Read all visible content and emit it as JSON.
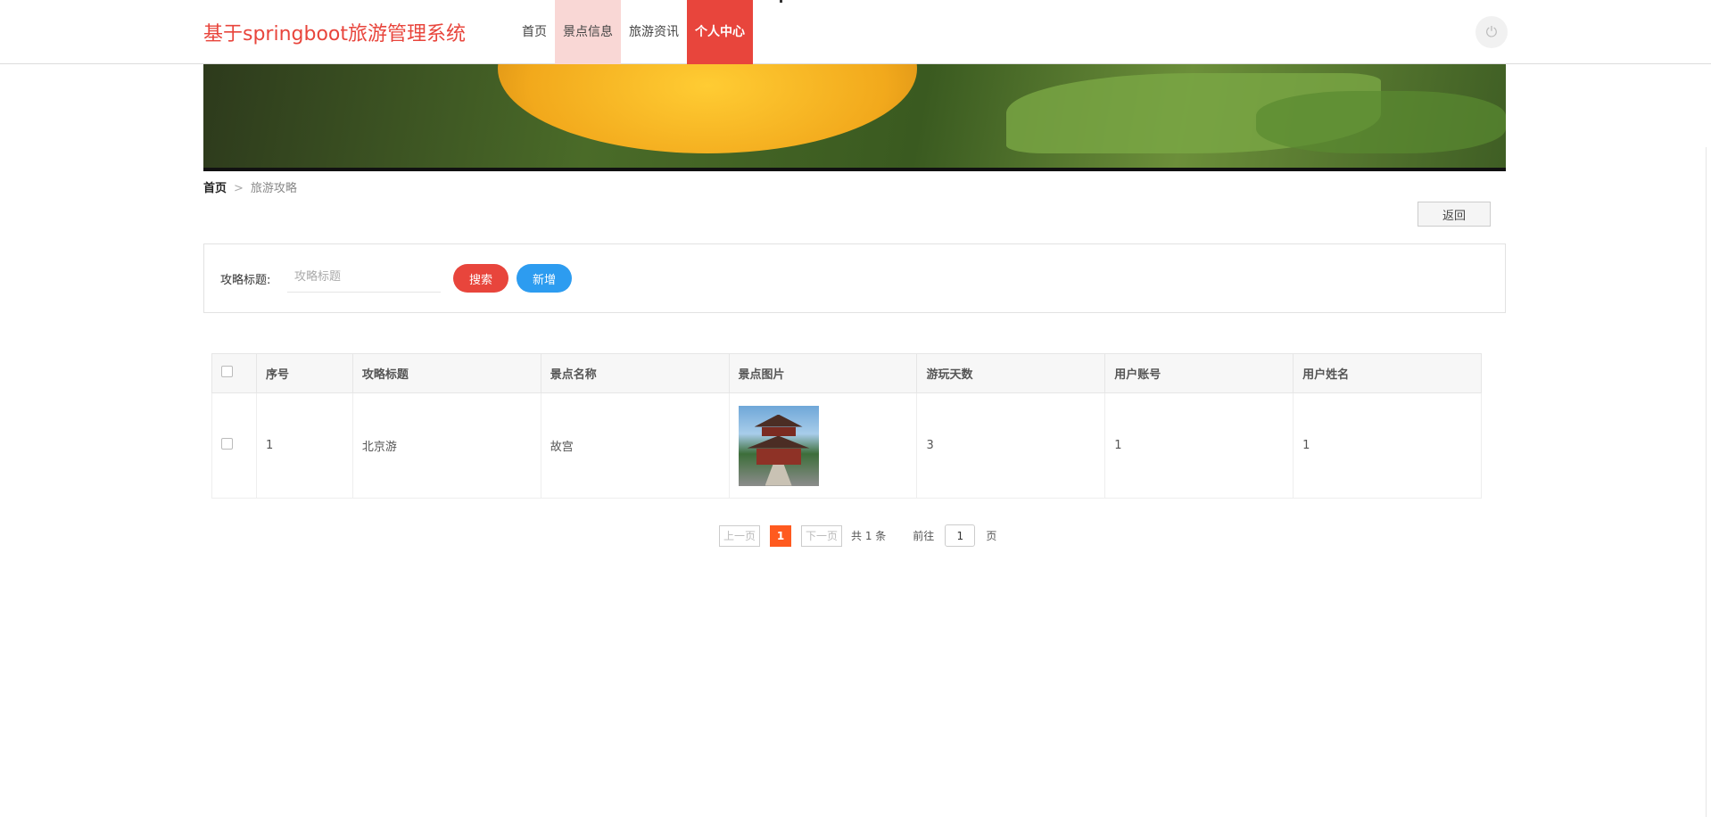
{
  "header": {
    "title": "基于springboot旅游管理系统",
    "nav": [
      "首页",
      "景点信息",
      "旅游资讯",
      "个人中心"
    ],
    "power_icon": "power-icon"
  },
  "breadcrumb": {
    "home": "首页",
    "separator": ">",
    "current": "旅游攻略"
  },
  "back_label": "返回",
  "search": {
    "label": "攻略标题:",
    "placeholder": "攻略标题",
    "value": "",
    "search_button": "搜索",
    "add_button": "新增"
  },
  "table": {
    "columns": [
      "序号",
      "攻略标题",
      "景点名称",
      "景点图片",
      "游玩天数",
      "用户账号",
      "用户姓名"
    ],
    "rows": [
      {
        "index": "1",
        "title": "北京游",
        "spot": "故宫",
        "image": "pagoda-photo",
        "days": "3",
        "account": "1",
        "name": "1"
      }
    ]
  },
  "pagination": {
    "prev": "上一页",
    "current": "1",
    "next": "下一页",
    "total": "共 1 条",
    "goto_label": "前往",
    "goto_value": "1",
    "page_suffix": "页"
  },
  "colors": {
    "accent": "#e8453c",
    "add": "#2d9cf0",
    "page_active": "#ff5a1f"
  }
}
